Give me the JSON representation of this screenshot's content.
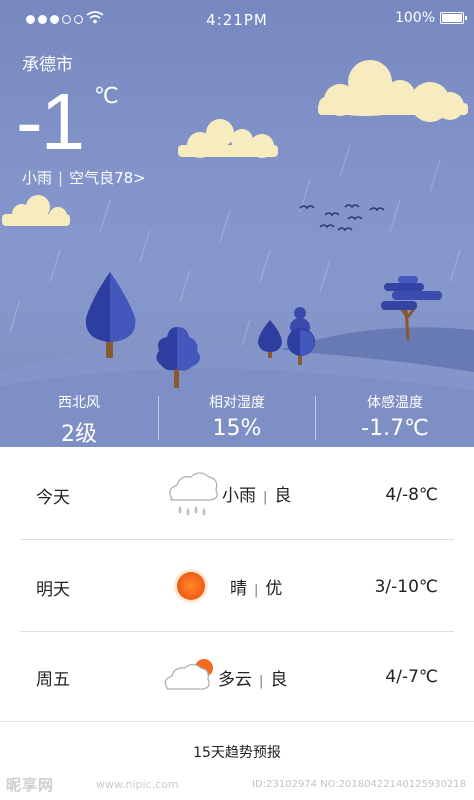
{
  "status_bar": {
    "time": "4:21PM",
    "battery": "100%",
    "signal_bars": 5,
    "signal_bars_filled": 3
  },
  "current": {
    "city": "承德市",
    "temperature": "-1",
    "unit": "℃",
    "condition": "小雨",
    "separator": "|",
    "air_quality": "空气良78>"
  },
  "stats": [
    {
      "label": "西北风",
      "value": "2级"
    },
    {
      "label": "相对湿度",
      "value": "15%"
    },
    {
      "label": "体感温度",
      "value": "-1.7℃"
    }
  ],
  "forecast": [
    {
      "day": "今天",
      "icon": "light-rain-cloud-icon",
      "condition": "小雨",
      "separator": "|",
      "quality": "良",
      "temp_range": "4/-8℃"
    },
    {
      "day": "明天",
      "icon": "sun-icon",
      "condition": "晴",
      "separator": "|",
      "quality": "优",
      "temp_range": "3/-10℃"
    },
    {
      "day": "周五",
      "icon": "partly-cloudy-icon",
      "condition": "多云",
      "separator": "|",
      "quality": "良",
      "temp_range": "4/-7℃"
    }
  ],
  "trend_link": "15天趋势预报",
  "watermark": {
    "logo": "昵享网",
    "url": "www.nipic.com",
    "id": "ID:23102974 NO:20180422140125930218"
  },
  "colors": {
    "sky_top": "#7688bf",
    "sky_bottom": "#8597cc",
    "hill": "#8395c9",
    "tree_blue": "#3345a6",
    "trunk": "#8a5a2e",
    "cloud": "#f7ecbf",
    "sun": "#f26a1b"
  }
}
